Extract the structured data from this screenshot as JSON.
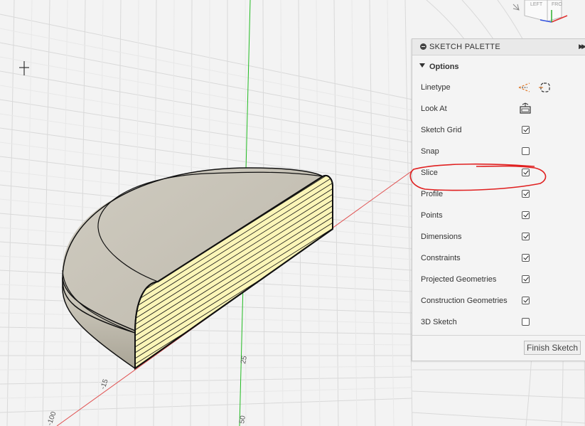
{
  "palette": {
    "title": "SKETCH PALETTE",
    "section": "Options",
    "options": [
      {
        "label": "Linetype",
        "control": "linetype-icons"
      },
      {
        "label": "Look At",
        "control": "look-at-icon"
      },
      {
        "label": "Sketch Grid",
        "control": "checkbox",
        "checked": true
      },
      {
        "label": "Snap",
        "control": "checkbox",
        "checked": false
      },
      {
        "label": "Slice",
        "control": "checkbox",
        "checked": true
      },
      {
        "label": "Profile",
        "control": "checkbox",
        "checked": true
      },
      {
        "label": "Points",
        "control": "checkbox",
        "checked": true
      },
      {
        "label": "Dimensions",
        "control": "checkbox",
        "checked": true
      },
      {
        "label": "Constraints",
        "control": "checkbox",
        "checked": true
      },
      {
        "label": "Projected Geometries",
        "control": "checkbox",
        "checked": true
      },
      {
        "label": "Construction Geometries",
        "control": "checkbox",
        "checked": true
      },
      {
        "label": "3D Sketch",
        "control": "checkbox",
        "checked": false
      }
    ],
    "finish_label": "Finish Sketch"
  },
  "viewcube": {
    "left_label": "LEFT",
    "front_label": "FRO"
  },
  "axis_ticks": {
    "t1": "-15",
    "t2": "25",
    "t3": "-100",
    "t4": "50"
  },
  "colors": {
    "annotation": "#e02020",
    "section_face": "#fbf5b8",
    "body": "#c8c4b8",
    "y_axis": "#22bb22",
    "x_axis": "#e05050"
  }
}
